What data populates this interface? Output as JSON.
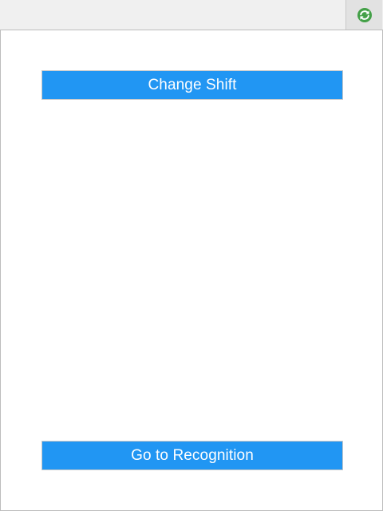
{
  "topbar": {
    "refresh_icon": "refresh-icon",
    "icon_color": "#43a047"
  },
  "buttons": {
    "change_shift_label": "Change Shift",
    "go_to_recognition_label": "Go to Recognition"
  },
  "colors": {
    "button_blue": "#2196f3",
    "topbar_bg": "#f0f0f0"
  }
}
